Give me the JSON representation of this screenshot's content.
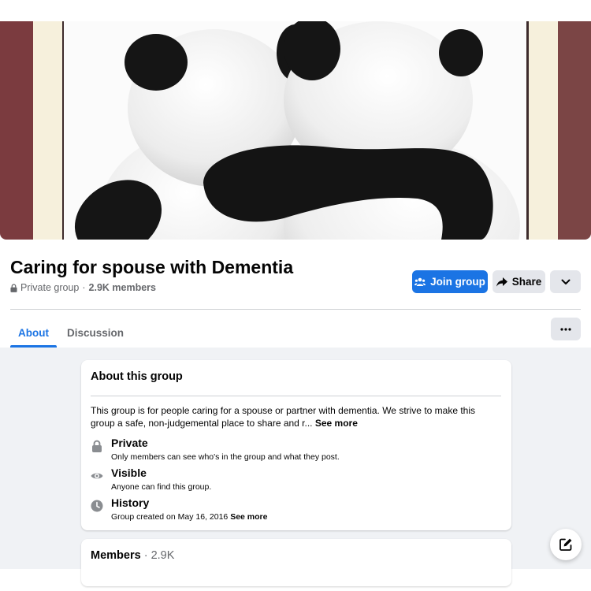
{
  "group": {
    "name": "Caring for spouse with Dementia",
    "privacy": "Private group",
    "separator": "·",
    "members_count": "2.9K members"
  },
  "actions": {
    "join_label": "Join group",
    "share_label": "Share"
  },
  "tabs": [
    {
      "label": "About",
      "active": true
    },
    {
      "label": "Discussion",
      "active": false
    }
  ],
  "about": {
    "title": "About this group",
    "description": "This group is for people caring for a spouse or partner with dementia. We strive to make this group a safe, non-judgemental place to share and r...",
    "see_more": "See more",
    "features": [
      {
        "icon": "lock-icon",
        "title": "Private",
        "subtitle": "Only members can see who's in the group and what they post."
      },
      {
        "icon": "eye-icon",
        "title": "Visible",
        "subtitle": "Anyone can find this group."
      },
      {
        "icon": "clock-icon",
        "title": "History",
        "subtitle": "Group created on May 16, 2016",
        "link": "See more"
      }
    ]
  },
  "members": {
    "label": "Members",
    "separator": "·",
    "count": "2.9K"
  },
  "colors": {
    "accent": "#1b74e4",
    "secondary_button": "#e4e6eb",
    "page_background": "#f0f2f5",
    "muted_text": "#65676b"
  }
}
